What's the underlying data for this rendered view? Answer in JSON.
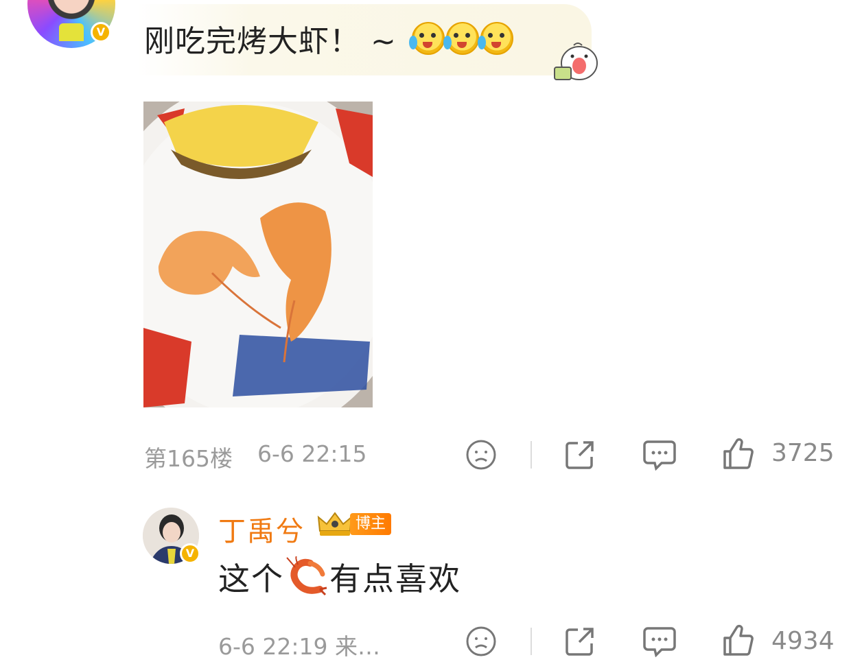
{
  "comment": {
    "text": "刚吃完烤大虾！ ~",
    "emojis": [
      "crying-face-emoji",
      "crying-face-emoji",
      "crying-face-emoji"
    ],
    "floor": "第165楼",
    "time": "6-6 22:15",
    "likes": "3725"
  },
  "reply": {
    "author": "丁禹兮",
    "badge": "博主",
    "text_before": "这个",
    "text_after": "有点喜欢",
    "time": "6-6 22:19 来…",
    "likes": "4934"
  },
  "colors": {
    "author_name": "#f07a12",
    "verified_badge": "#f5b300",
    "meta_text": "#9a9a9a"
  }
}
